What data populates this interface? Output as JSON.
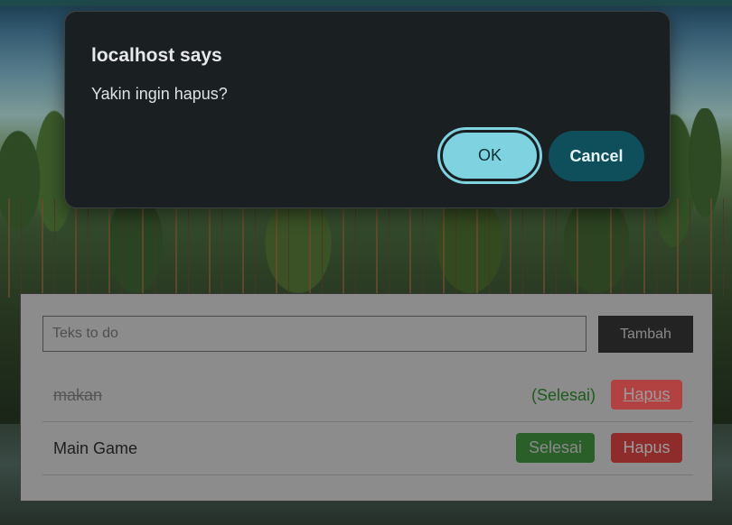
{
  "dialog": {
    "title": "localhost says",
    "message": "Yakin ingin hapus?",
    "ok_label": "OK",
    "cancel_label": "Cancel"
  },
  "todo": {
    "input_placeholder": "Teks to do",
    "input_value": "",
    "add_label": "Tambah",
    "items": [
      {
        "text": "makan",
        "status_label": "(Selesai)",
        "delete_label": "Hapus",
        "done": true
      },
      {
        "text": "Main Game",
        "complete_label": "Selesai",
        "delete_label": "Hapus",
        "done": false
      }
    ]
  },
  "colors": {
    "ok_button": "#7fd3e0",
    "cancel_button": "#0f4f5c",
    "delete_button": "#8e2b2b",
    "complete_button": "#2a5f2a"
  }
}
